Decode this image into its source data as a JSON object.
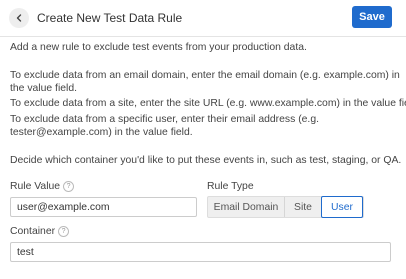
{
  "header": {
    "title": "Create New Test Data Rule",
    "save_label": "Save"
  },
  "description": {
    "intro": "Add a new rule to exclude test events from your production data.",
    "instructions": [
      "To exclude data from an email domain, enter the email domain (e.g. example.com) in the value field.",
      "To exclude data from a site, enter the site URL (e.g. www.example.com) in the value field.",
      "To exclude data from a specific user, enter their email address (e.g. tester@example.com) in the value field."
    ],
    "container_hint": "Decide which container you'd like to put these events in, such as test, staging, or QA."
  },
  "form": {
    "rule_value": {
      "label": "Rule Value",
      "value": "user@example.com"
    },
    "rule_type": {
      "label": "Rule Type",
      "options": [
        "Email Domain",
        "Site",
        "User"
      ],
      "selected": "User"
    },
    "container": {
      "label": "Container",
      "value": "test"
    }
  },
  "colors": {
    "accent": "#1f6bcd"
  },
  "icons": {
    "back": "chevron-left-icon",
    "help": "help-circle-icon"
  }
}
